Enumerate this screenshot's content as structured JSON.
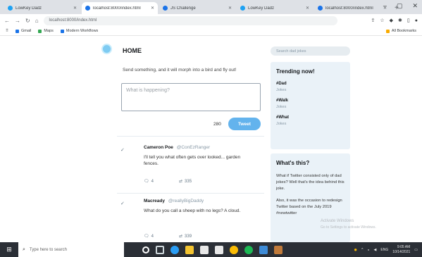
{
  "browser": {
    "tabs": [
      {
        "label": "LowKey Dadz",
        "active": false
      },
      {
        "label": "localhost:8000/index.html",
        "active": true
      },
      {
        "label": "JS Challenge",
        "active": false
      },
      {
        "label": "LowKey Dadz",
        "active": false
      },
      {
        "label": "localhost:8000/index.html",
        "active": false
      }
    ],
    "url": "localhost:8000/index.html",
    "bookmarks": [
      "Gmail",
      "Maps",
      "Modern Workflows"
    ],
    "bookmarks_other": "All Bookmarks"
  },
  "feed": {
    "home_title": "HOME",
    "tagline": "Send something, and it will morph into a bird and fly out!",
    "compose_placeholder": "What is happening?",
    "char_count": "280",
    "tweet_button": "Tweet"
  },
  "tweets": [
    {
      "name": "Cameron Poe",
      "handle": "@ConEzRanger",
      "text": "I'll tell you what often gets over looked... garden fences.",
      "replies": "4",
      "retweets": "335"
    },
    {
      "name": "Macready",
      "handle": "@reallyBigDaddy",
      "text": "What do you call a sheep with no legs? A cloud.",
      "replies": "4",
      "retweets": "339"
    }
  ],
  "sidebar": {
    "search_placeholder": "Search dad jokes",
    "trending_title": "Trending now!",
    "trends": [
      {
        "tag": "#Dad",
        "sub": "Jokes"
      },
      {
        "tag": "#Walk",
        "sub": "Jokes"
      },
      {
        "tag": "#What",
        "sub": "Jokes"
      }
    ],
    "about_title": "What's this?",
    "about_p1": "What if Twitter consisted only of dad jokes? Well that's the idea behind this joke.",
    "about_p2": "Also, it was the occasion to redesign Twitter based on the July 2019 #newtwitter"
  },
  "watermark": {
    "line1": "Activate Windows",
    "line2": "Go to Settings to activate Windows."
  },
  "taskbar": {
    "search_placeholder": "Type here to search",
    "time": "9:05 AM",
    "date": "10/14/2021"
  },
  "colors": {
    "accent": "#1da1f2",
    "tweet_button": "#63b3ed",
    "panel_bg": "#eaf2f8",
    "taskbar_bg": "#2b2f36"
  }
}
